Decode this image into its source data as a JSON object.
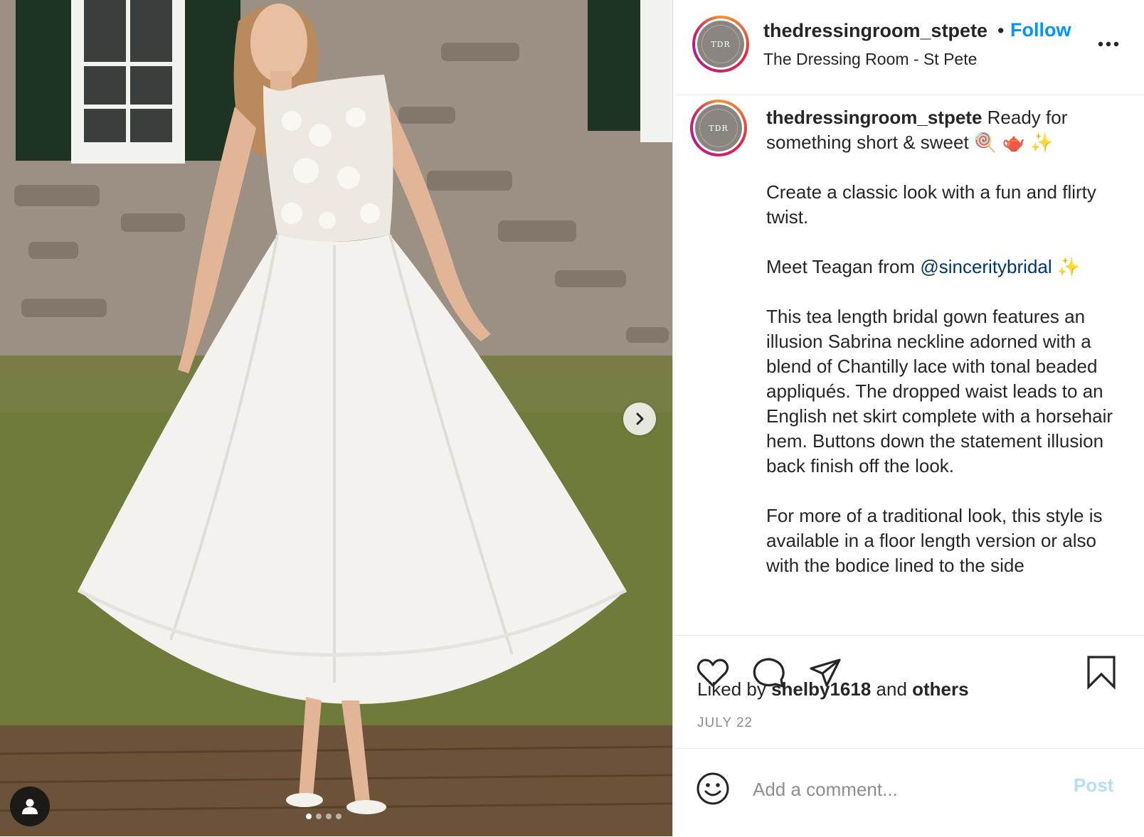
{
  "post": {
    "author": {
      "username": "thedressingroom_stpete",
      "display_username": "thedressingroom_stpet\u0000",
      "location": "The Dressing Room - St Pete",
      "avatar_initials": "TDR",
      "follow_label": "Follow",
      "separator": "•"
    },
    "caption": {
      "username": "thedressingroom_stpete",
      "intro": "Ready for something short & sweet 🍭 🫖 ✨",
      "paragraph_2": "Create a classic look with a fun and flirty twist.",
      "paragraph_3_prefix": "Meet Teagan from ",
      "mention": "@sinceritybridal",
      "paragraph_3_suffix": " ✨",
      "paragraph_4": "This tea length bridal gown features an illusion Sabrina neckline adorned with a blend of Chantilly lace with tonal beaded appliqués. The dropped waist leads to an English net skirt complete with a horsehair hem. Buttons down the statement illusion back finish off the look.",
      "paragraph_5": "For more of a traditional look, this style is available in a floor length version or also with the bodice lined to the side"
    },
    "likes": {
      "prefix": "Liked by ",
      "user": "shelby1618",
      "middle": " and ",
      "others": "others"
    },
    "date": "JULY 22",
    "comment": {
      "placeholder": "Add a comment...",
      "post_label": "Post"
    },
    "carousel": {
      "slide_count": 4,
      "active_index": 0
    },
    "icons": {
      "like": "heart-icon",
      "comment": "comment-bubble-icon",
      "share": "paper-plane-icon",
      "save": "bookmark-icon",
      "more": "more-dots-icon",
      "next": "chevron-right-icon",
      "tags": "user-tag-icon",
      "emoji": "smiley-icon"
    },
    "colors": {
      "follow": "#0095f6",
      "mention": "#00376b",
      "post_disabled": "#b2dffc",
      "muted": "#8e8e8e"
    }
  }
}
